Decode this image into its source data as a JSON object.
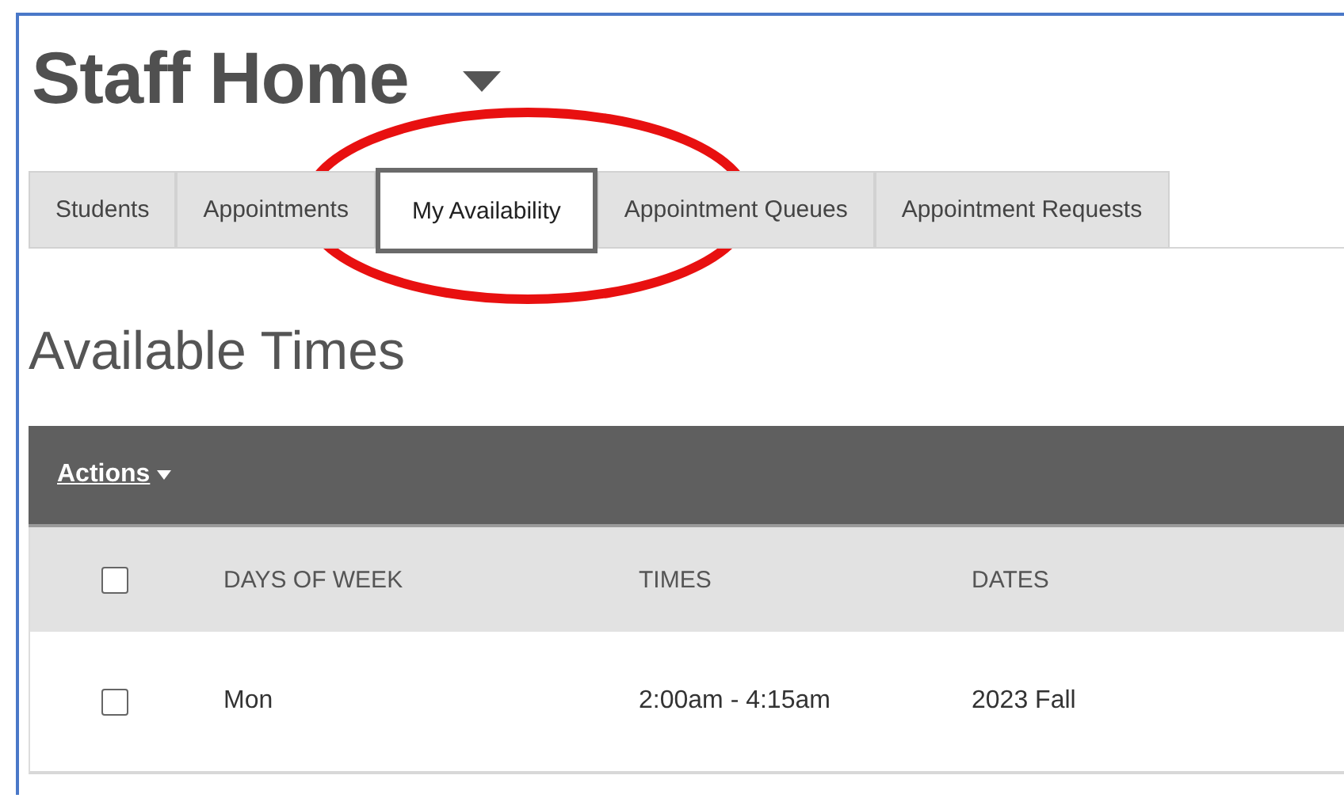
{
  "page": {
    "title": "Staff Home"
  },
  "tabs": [
    {
      "label": "Students",
      "selected": false
    },
    {
      "label": "Appointments",
      "selected": false
    },
    {
      "label": "My Availability",
      "selected": true
    },
    {
      "label": "Appointment Queues",
      "selected": false
    },
    {
      "label": "Appointment Requests",
      "selected": false
    }
  ],
  "section": {
    "title": "Available Times"
  },
  "toolbar": {
    "actions": "Actions"
  },
  "table": {
    "header_checked": false,
    "columns": [
      "DAYS OF WEEK",
      "TIMES",
      "DATES"
    ],
    "rows": [
      {
        "checked": false,
        "cells": [
          "Mon",
          "2:00am - 4:15am",
          "2023 Fall"
        ]
      }
    ]
  }
}
